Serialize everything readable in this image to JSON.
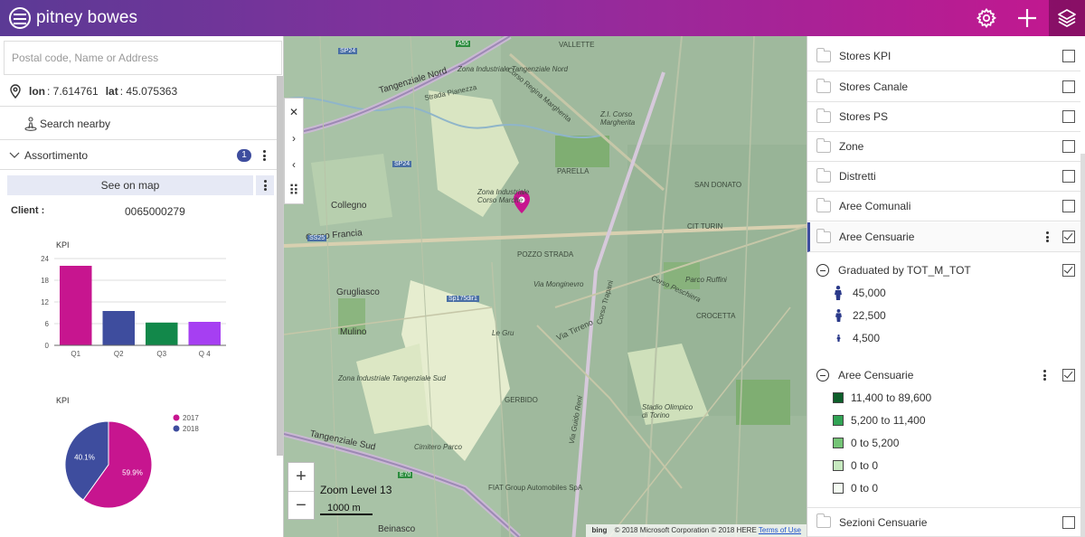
{
  "header": {
    "brand": "pitney bowes",
    "settings_icon": "gear-icon",
    "add_icon": "plus-icon",
    "layers_icon": "layers-icon",
    "accent": "#3e4d9e"
  },
  "left": {
    "search_placeholder": "Postal code, Name or Address",
    "coords": {
      "lon_label": "lon",
      "lon_value": ": 7.614761",
      "lat_label": "lat",
      "lat_value": ": 45.075363"
    },
    "search_nearby": "Search nearby",
    "section_title": "Assortimento",
    "section_badge": "1",
    "see_on_map": "See on map",
    "client_label": "Client :",
    "client_value": "0065000279"
  },
  "bar_chart": {
    "title": "KPI",
    "type": "bar",
    "categories": [
      "Q1",
      "Q2",
      "Q3",
      "Q 4"
    ],
    "values": [
      22,
      9.5,
      6.3,
      6.5
    ],
    "colors": [
      "#c7158f",
      "#3e4d9e",
      "#12884a",
      "#a63ff2"
    ],
    "yticks": [
      "0",
      "6",
      "12",
      "18",
      "24"
    ],
    "ylim": [
      0,
      24
    ]
  },
  "pie_chart": {
    "title": "KPI",
    "type": "pie",
    "labels": [
      "2017",
      "2018"
    ],
    "values": [
      59.9,
      40.1
    ],
    "value_labels": [
      "59.9%",
      "40.1%"
    ],
    "colors": [
      "#c7158f",
      "#3e4d9e"
    ]
  },
  "chart_data": [
    {
      "type": "bar",
      "title": "KPI",
      "categories": [
        "Q1",
        "Q2",
        "Q3",
        "Q 4"
      ],
      "values": [
        22,
        9.5,
        6.3,
        6.5
      ],
      "ylim": [
        0,
        24
      ]
    },
    {
      "type": "pie",
      "title": "KPI",
      "labels": [
        "2017",
        "2018"
      ],
      "values": [
        59.9,
        40.1
      ]
    }
  ],
  "map": {
    "labels": {
      "tangenziale_nord": "Tangenziale Nord",
      "tangenziale_sud": "Tangenziale Sud",
      "zona_ind_nord": "Zona Industriale Tangenziale Nord",
      "zona_ind_sud": "Zona Industriale Tangenziale Sud",
      "corso_francia": "Corso Francia",
      "corso_regina": "Corso Regina Margherita",
      "corso_trapani": "Corso Trapani",
      "via_tirreno": "Via Tirreno",
      "strada_pianezza": "Strada Pianezza",
      "collegno": "Collegno",
      "grugliasco": "Grugliasco",
      "mulino": "Mulino",
      "beinasco": "Beinasco",
      "pozzo_strada": "POZZO STRADA",
      "parella": "PARELLA",
      "san_donato": "SAN DONATO",
      "cit_turin": "CIT TURIN",
      "crocetta": "CROCETTA",
      "gerbido": "GERBIDO",
      "vallette": "VALLETTE",
      "zona_ind_corso": "Zona Industriale Corso Marche",
      "cimitero": "Cimitero Parco",
      "fiat": "FIAT Group Automobiles SpA",
      "stadio": "Stadio Olimpico di Torino",
      "le_gru": "Le Gru",
      "via_monginevro": "Via Monginevro",
      "corso_peschiera": "Corso Peschiera",
      "via_guido_reni": "Via Guido Reni",
      "zi_lucento": "Z.I. Corso Margherita",
      "parco_ruffini": "Parco Ruffini",
      "sp24": "SP24",
      "sp24b": "SP24",
      "a55": "A55",
      "s25": "SS25",
      "sp175": "Sp175dir1",
      "e70": "E70"
    },
    "side_buttons": [
      "✕",
      "›",
      "‹",
      "⠿"
    ],
    "zoom_in": "+",
    "zoom_out": "−",
    "zoom_level": "Zoom Level 13",
    "scale": "1000 m",
    "attribution": "© 2018 Microsoft Corporation © 2018 HERE",
    "bing": "bing",
    "terms": "Terms of Use",
    "pin_color": "#c7158f"
  },
  "layers": {
    "rows": [
      {
        "label": "Stores KPI",
        "checked": false
      },
      {
        "label": "Stores Canale",
        "checked": false
      },
      {
        "label": "Stores PS",
        "checked": false
      },
      {
        "label": "Zone",
        "checked": false
      },
      {
        "label": "Distretti",
        "checked": false
      },
      {
        "label": "Aree Comunali",
        "checked": false
      },
      {
        "label": "Aree Censuarie",
        "checked": true
      }
    ],
    "graduated_title": "Graduated by TOT_M_TOT",
    "graduated_items": [
      "45,000",
      "22,500",
      "4,500"
    ],
    "choropleth_title": "Aree Censuarie",
    "choropleth_items": [
      {
        "label": "11,400 to 89,600",
        "color": "#0d5e2a"
      },
      {
        "label": "5,200 to 11,400",
        "color": "#31a354"
      },
      {
        "label": "0 to 5,200",
        "color": "#74c476"
      },
      {
        "label": "0 to 0",
        "color": "#c7e9c0"
      },
      {
        "label": "0 to 0",
        "color": "#f4fbf2"
      }
    ],
    "last_row": "Sezioni Censuarie"
  }
}
